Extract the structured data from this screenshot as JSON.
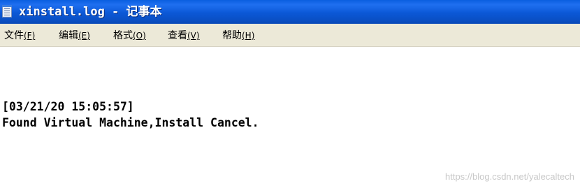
{
  "window": {
    "title": "xinstall.log - 记事本",
    "icon": "notepad-icon"
  },
  "menu": {
    "items": [
      {
        "label": "文件",
        "accelerator": "(F)"
      },
      {
        "label": "编辑",
        "accelerator": "(E)"
      },
      {
        "label": "格式",
        "accelerator": "(O)"
      },
      {
        "label": "查看",
        "accelerator": "(V)"
      },
      {
        "label": "帮助",
        "accelerator": "(H)"
      }
    ]
  },
  "document": {
    "lines": [
      "[03/21/20 15:05:57]",
      "Found Virtual Machine,Install Cancel."
    ]
  },
  "watermark": "https://blog.csdn.net/yalecaltech",
  "colors": {
    "titlebar": "#0b58d6",
    "menubar": "#ece9d8",
    "text": "#000000"
  }
}
